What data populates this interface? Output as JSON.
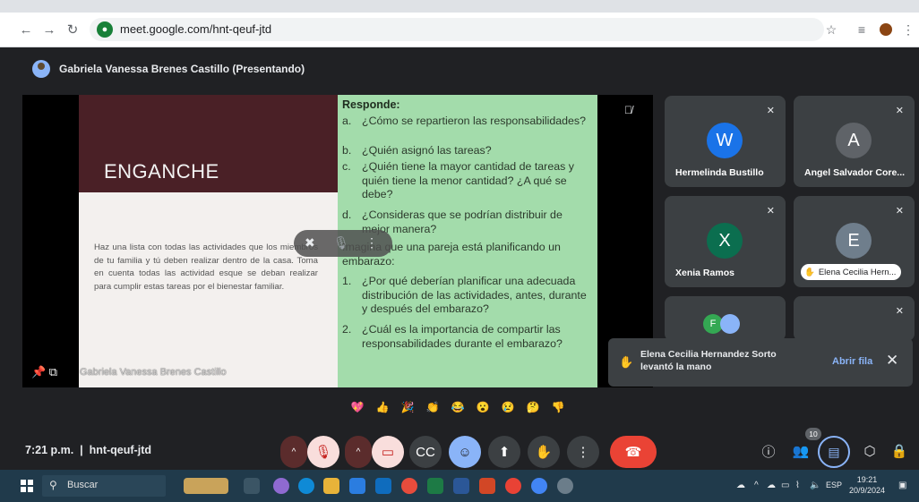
{
  "browser": {
    "url": "meet.google.com/hnt-qeuf-jtd",
    "back_icon": "arrow-left-icon",
    "forward_icon": "arrow-right-icon",
    "reload_icon": "reload-icon"
  },
  "presenter": {
    "label": "Gabriela Vanessa Brenes Castillo (Presentando)"
  },
  "slide": {
    "title": "ENGANCHE",
    "body": "Haz una lista con todas las actividades que los miembros de tu familia y tú deben realizar dentro de la casa. Toma en cuenta todas las actividad esque se deban realizar para cumplir estas tareas por el bienestar familiar.",
    "responde_title": "Responde:",
    "questions": [
      {
        "n": "a.",
        "t": "¿Cómo se repartieron las responsabilidades?"
      },
      {
        "n": "b.",
        "t": "¿Quién asignó las tareas?"
      },
      {
        "n": "c.",
        "t": "¿Quién tiene la mayor cantidad de tareas y quién tiene la menor cantidad? ¿A qué se debe?"
      },
      {
        "n": "d.",
        "t": "¿Consideras que se podrían distribuir de mejor manera?"
      }
    ],
    "imagine": "Imagina que una pareja está planificando un embarazo:",
    "questions2": [
      {
        "n": "1.",
        "t": "¿Por qué deberían planificar una adecuada distribución de las actividades, antes, durante y después del embarazo?"
      },
      {
        "n": "2.",
        "t": "¿Cuál es la importancia de compartir las responsabilidades durante el embarazo?"
      }
    ],
    "presenter_tag": "Gabriela Vanessa Brenes Castillo"
  },
  "participants": [
    {
      "initial": "W",
      "name": "Hermelinda Bustillo",
      "color": "#1a73e8"
    },
    {
      "initial": "A",
      "name": "Angel Salvador Core...",
      "color": "#5f6368"
    },
    {
      "initial": "X",
      "name": "Xenia Ramos",
      "color": "#0b6e4f"
    },
    {
      "initial": "E",
      "name": "Elena Cecilia Hern...",
      "color": "#6f7e8c"
    }
  ],
  "toast": {
    "text": "Elena Cecilia Hernandez Sorto levantó la mano",
    "action": "Abrir fila"
  },
  "meeting": {
    "time": "7:21 p.m.",
    "code": "hnt-qeuf-jtd",
    "participant_count": "10"
  },
  "taskbar": {
    "search_placeholder": "Buscar",
    "language": "ESP",
    "time": "19:21",
    "date": "20/9/2024"
  },
  "colors": {
    "end_call": "#ea4335",
    "muted_control": "#f9dedc",
    "active_control": "#8ab4f8",
    "slide_green": "#a3dcab"
  }
}
